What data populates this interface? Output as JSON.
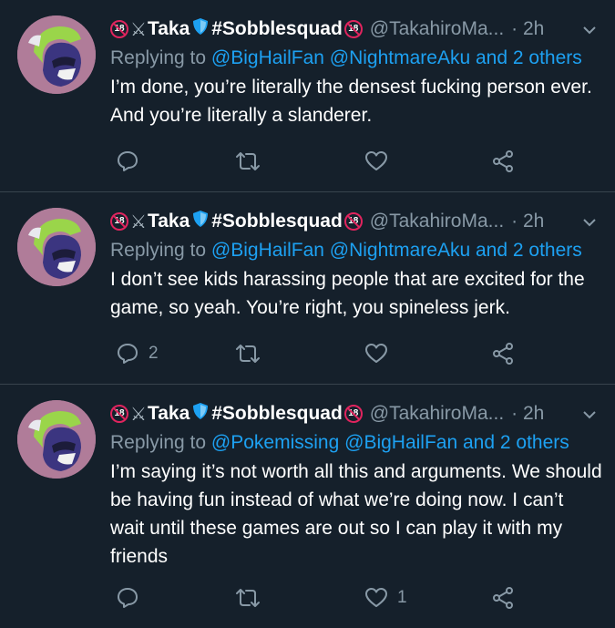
{
  "colors": {
    "background": "#15202b",
    "divider": "#38444d",
    "secondary_text": "#8899a6",
    "link": "#1da1f2",
    "badge_red": "#e0245e",
    "shield_blue": "#1da1f2"
  },
  "tweets": [
    {
      "badge_left": "18",
      "swords": "⚔",
      "name": "Taka",
      "hashtag": "#Sobblesquad",
      "badge_right": "18",
      "handle": "@TakahiroMa...",
      "time": "· 2h",
      "replying_prefix": "Replying to",
      "mentions": [
        "@BigHailFan",
        "@NightmareAku"
      ],
      "others": "and 2 others",
      "text": "I’m done, you’re literally the densest fucking person ever. And you’re literally a slanderer.",
      "reply_count": "",
      "retweet_count": "",
      "like_count": ""
    },
    {
      "badge_left": "18",
      "swords": "⚔",
      "name": "Taka",
      "hashtag": "#Sobblesquad",
      "badge_right": "18",
      "handle": "@TakahiroMa...",
      "time": "· 2h",
      "replying_prefix": "Replying to",
      "mentions": [
        "@BigHailFan",
        "@NightmareAku"
      ],
      "others": "and 2 others",
      "text": "I don’t see kids harassing people that are excited for the game, so yeah. You’re right, you spineless jerk.",
      "reply_count": "2",
      "retweet_count": "",
      "like_count": ""
    },
    {
      "badge_left": "18",
      "swords": "⚔",
      "name": "Taka",
      "hashtag": "#Sobblesquad",
      "badge_right": "18",
      "handle": "@TakahiroMa...",
      "time": "· 2h",
      "replying_prefix": "Replying to",
      "mentions": [
        "@Pokemissing",
        "@BigHailFan"
      ],
      "others": "and 2 others",
      "text": "I’m saying it’s not worth all this and arguments. We should be having fun instead of what we’re doing now. I can’t wait until these games are out so I can play it with my friends",
      "reply_count": "",
      "retweet_count": "",
      "like_count": "1"
    }
  ]
}
